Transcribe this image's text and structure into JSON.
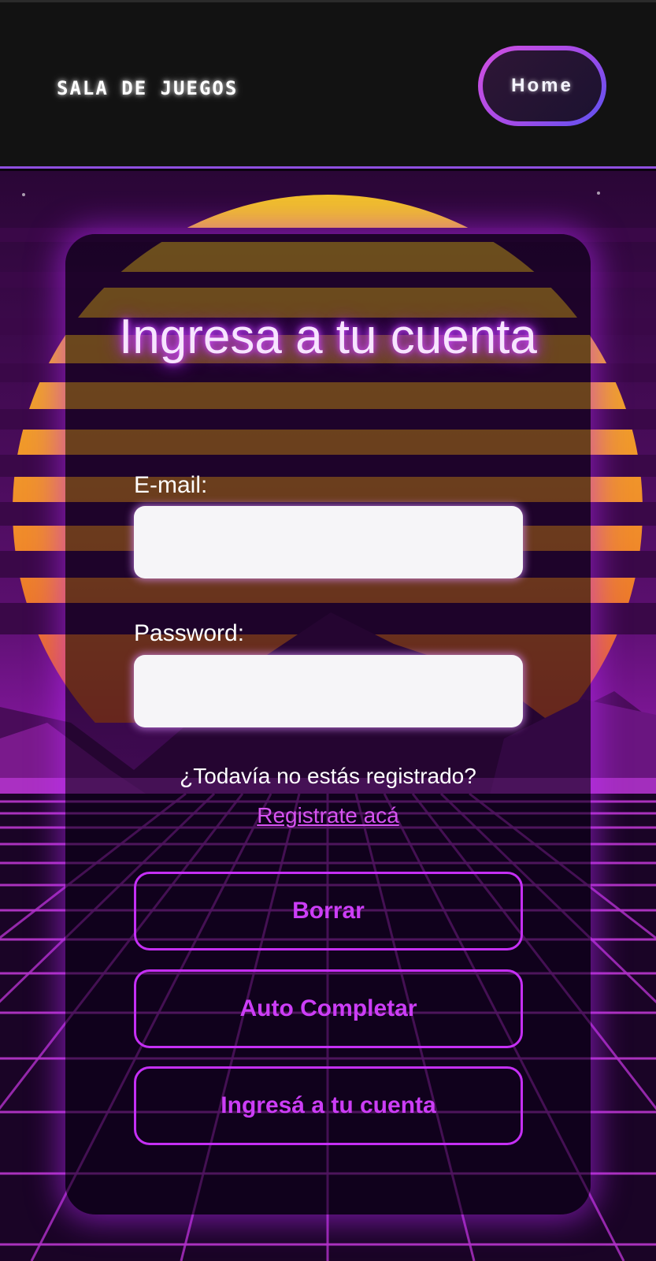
{
  "header": {
    "brand": "SALA DE JUEGOS",
    "home_label": "Home"
  },
  "login": {
    "title": "Ingresa a tu cuenta",
    "email_label": "E-mail:",
    "email_value": "",
    "password_label": "Password:",
    "password_value": "",
    "register_question": "¿Todavía no estás registrado?",
    "register_link": "Registrate acá",
    "buttons": {
      "clear": "Borrar",
      "autocomplete": "Auto Completar",
      "submit": "Ingresá a tu cuenta"
    }
  },
  "colors": {
    "accent": "#c52ff5",
    "header_bg": "#121212",
    "title_glow": "#d24cff"
  }
}
